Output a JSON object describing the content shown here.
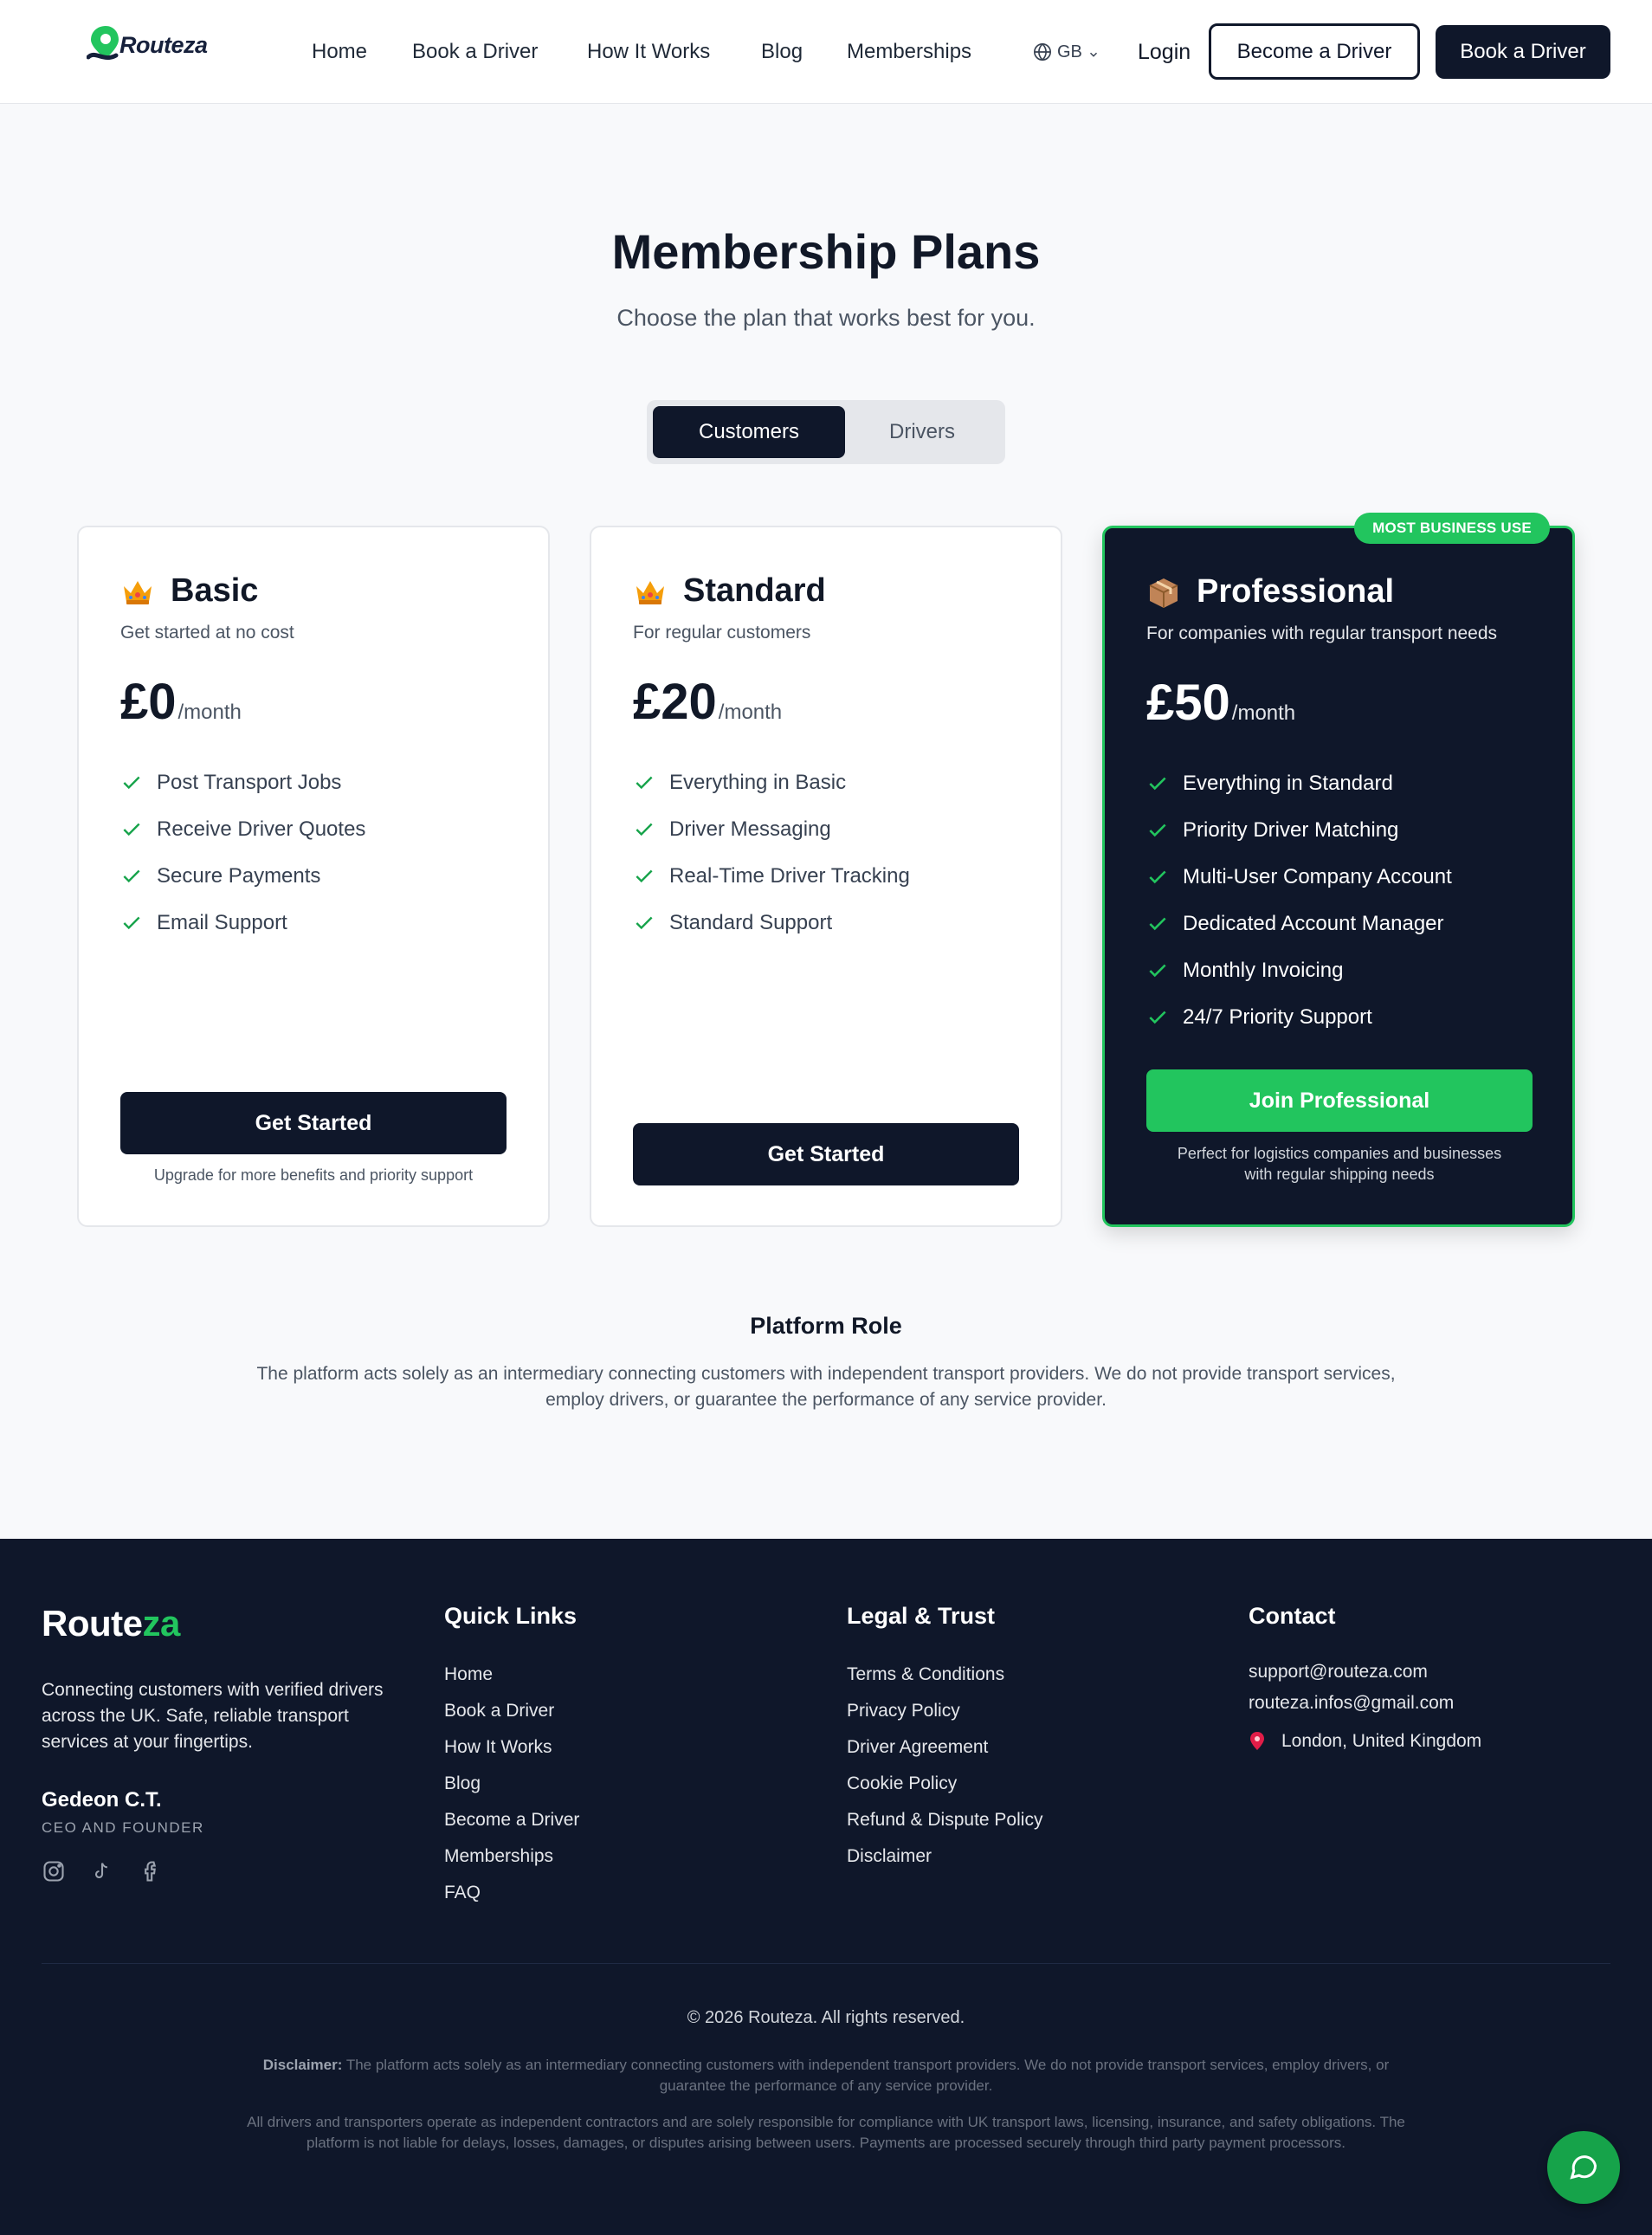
{
  "brand": {
    "name": "Routeza",
    "name_main": "Route",
    "name_accent": "za",
    "accent_color": "#22c55e",
    "dark_color": "#0f172a"
  },
  "nav": {
    "links": [
      "Home",
      "Book a Driver",
      "How It Works",
      "Blog",
      "Memberships"
    ],
    "language": "GB",
    "login": "Login",
    "become_driver": "Become a Driver",
    "book_driver": "Book a Driver"
  },
  "hero": {
    "title": "Membership Plans",
    "subtitle": "Choose the plan that works best for you."
  },
  "audience_toggle": {
    "active": "Customers",
    "inactive": "Drivers"
  },
  "plans": [
    {
      "icon": "crown-icon",
      "name": "Basic",
      "description": "Get started at no cost",
      "price": "£0",
      "period": "/month",
      "features": [
        "Post Transport Jobs",
        "Receive Driver Quotes",
        "Secure Payments",
        "Email Support"
      ],
      "button": "Get Started",
      "note": "Upgrade for more benefits and priority support"
    },
    {
      "icon": "crown-icon",
      "name": "Standard",
      "description": "For regular customers",
      "price": "£20",
      "period": "/month",
      "features": [
        "Everything in Basic",
        "Driver Messaging",
        "Real-Time Driver Tracking",
        "Standard Support"
      ],
      "button": "Get Started"
    },
    {
      "icon": "package-icon",
      "badge": "MOST BUSINESS USE",
      "name": "Professional",
      "description": "For companies with regular transport needs",
      "price": "£50",
      "period": "/month",
      "features": [
        "Everything in Standard",
        "Priority Driver Matching",
        "Multi-User Company Account",
        "Dedicated Account Manager",
        "Monthly Invoicing",
        "24/7 Priority Support"
      ],
      "button": "Join Professional",
      "note_line1": "Perfect for logistics companies and businesses",
      "note_line2": "with regular shipping needs"
    }
  ],
  "platform_role": {
    "title": "Platform Role",
    "text": "The platform acts solely as an intermediary connecting customers with independent transport providers. We do not provide transport services, employ drivers, or guarantee the performance of any service provider."
  },
  "footer": {
    "about": "Connecting customers with verified drivers across the UK. Safe, reliable transport services at your fingertips.",
    "founder_name": "Gedeon C.T.",
    "founder_role": "CEO AND FOUNDER",
    "social_icons": [
      "instagram-icon",
      "tiktok-icon",
      "facebook-icon"
    ],
    "quick_links_title": "Quick Links",
    "quick_links": [
      "Home",
      "Book a Driver",
      "How It Works",
      "Blog",
      "Become a Driver",
      "Memberships",
      "FAQ"
    ],
    "legal_title": "Legal & Trust",
    "legal_links": [
      "Terms & Conditions",
      "Privacy Policy",
      "Driver Agreement",
      "Cookie Policy",
      "Refund & Dispute Policy",
      "Disclaimer"
    ],
    "contact_title": "Contact",
    "emails": [
      "support@routeza.com",
      "routeza.infos@gmail.com"
    ],
    "location": "London, United Kingdom",
    "copyright": "© 2026 Routeza. All rights reserved.",
    "disclaimer_label": "Disclaimer:",
    "disclaimer_text": "The platform acts solely as an intermediary connecting customers with independent transport providers. We do not provide transport services, employ drivers, or guarantee the performance of any service provider.",
    "disclaimer_text2": "All drivers and transporters operate as independent contractors and are solely responsible for compliance with UK transport laws, licensing, insurance, and safety obligations. The platform is not liable for delays, losses, damages, or disputes arising between users. Payments are processed securely through third party payment processors."
  },
  "chat": {
    "icon": "chat-bubble-icon"
  }
}
